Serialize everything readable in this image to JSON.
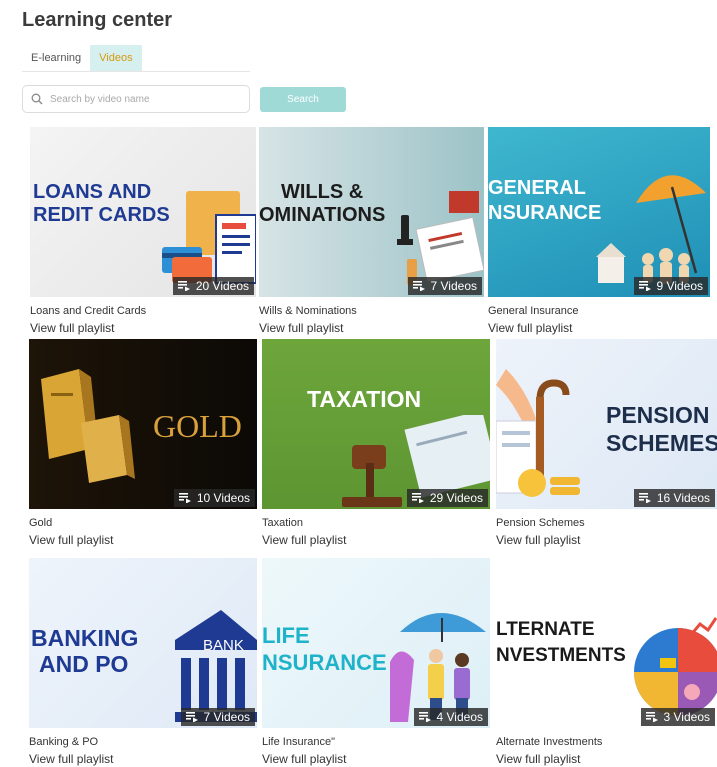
{
  "header": {
    "title": "Learning center"
  },
  "tabs": [
    {
      "label": "E-learning",
      "active": false
    },
    {
      "label": "Videos",
      "active": true
    }
  ],
  "search": {
    "placeholder": "Search by video name",
    "button_label": "Search"
  },
  "colors": {
    "accent": "#9fdad7",
    "active_tab_text": "#d59a12",
    "active_tab_bg": "#d6f0ef"
  },
  "playlists": [
    {
      "name": "Loans and Credit Cards",
      "thumb_text": [
        "LOANS AND",
        "REDIT CARDS"
      ],
      "count": "20 Videos",
      "link": "View full playlist"
    },
    {
      "name": "Wills & Nominations",
      "thumb_text": [
        "WILLS &",
        "OMINATIONS"
      ],
      "count": "7 Videos",
      "link": "View full playlist"
    },
    {
      "name": "General Insurance",
      "thumb_text": [
        "GENERAL",
        "NSURANCE"
      ],
      "count": "9 Videos",
      "link": "View full playlist"
    },
    {
      "name": "Gold",
      "thumb_text": [
        "GOLD"
      ],
      "count": "10 Videos",
      "link": "View full playlist"
    },
    {
      "name": "Taxation",
      "thumb_text": [
        "TAXATION"
      ],
      "count": "29 Videos",
      "link": "View full playlist"
    },
    {
      "name": "Pension Schemes",
      "thumb_text": [
        "PENSION",
        "SCHEMES"
      ],
      "count": "16 Videos",
      "link": "View full playlist"
    },
    {
      "name": "Banking & PO",
      "thumb_text": [
        "BANKING",
        "AND PO",
        "BANK"
      ],
      "count": "7 Videos",
      "link": "View full playlist"
    },
    {
      "name": "Life Insurance\"",
      "thumb_text": [
        "LIFE",
        "NSURANCE"
      ],
      "count": "4 Videos",
      "link": "View full playlist"
    },
    {
      "name": "Alternate Investments",
      "thumb_text": [
        "LTERNATE",
        "NVESTMENTS"
      ],
      "count": "3 Videos",
      "link": "View full playlist"
    }
  ]
}
